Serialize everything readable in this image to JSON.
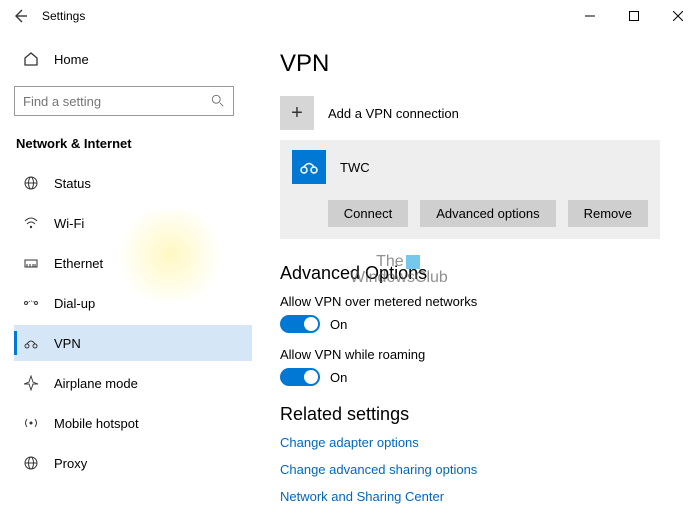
{
  "titlebar": {
    "title": "Settings"
  },
  "sidebar": {
    "home": "Home",
    "searchPlaceholder": "Find a setting",
    "section": "Network & Internet",
    "items": [
      {
        "label": "Status"
      },
      {
        "label": "Wi-Fi"
      },
      {
        "label": "Ethernet"
      },
      {
        "label": "Dial-up"
      },
      {
        "label": "VPN"
      },
      {
        "label": "Airplane mode"
      },
      {
        "label": "Mobile hotspot"
      },
      {
        "label": "Proxy"
      }
    ]
  },
  "main": {
    "title": "VPN",
    "addConnection": "Add a VPN connection",
    "vpn": {
      "name": "TWC",
      "connect": "Connect",
      "advanced": "Advanced options",
      "remove": "Remove"
    },
    "advancedOptions": {
      "heading": "Advanced Options",
      "meteredLabel": "Allow VPN over metered networks",
      "meteredState": "On",
      "roamingLabel": "Allow VPN while roaming",
      "roamingState": "On"
    },
    "related": {
      "heading": "Related settings",
      "links": [
        "Change adapter options",
        "Change advanced sharing options",
        "Network and Sharing Center"
      ]
    }
  },
  "watermark": {
    "line1": "The",
    "line2": "WindowsClub"
  }
}
